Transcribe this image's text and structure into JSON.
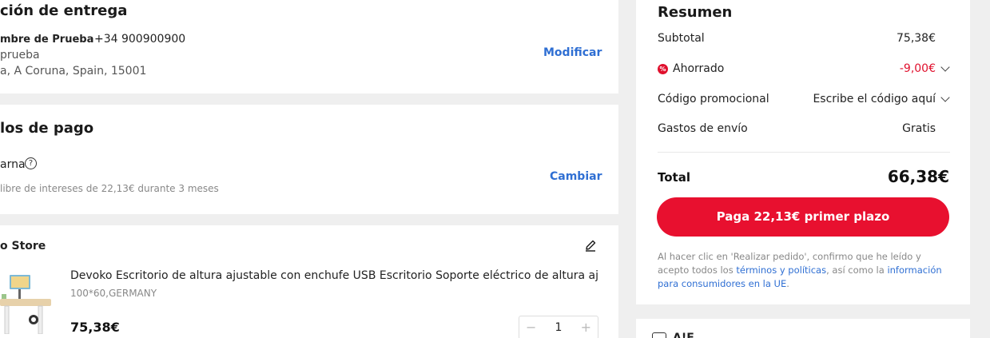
{
  "delivery": {
    "title": "ción de entrega",
    "name": "mbre de Prueba",
    "phone": "+34 900900900",
    "line1": "prueba",
    "line2": "a, A Coruna, Spain, 15001",
    "edit_label": "Modificar"
  },
  "payment": {
    "title": "los de pago",
    "method": "arna",
    "help_glyph": "?",
    "detail": "libre de intereses de 22,13€ durante 3 meses",
    "change_label": "Cambiar"
  },
  "store": {
    "name": "o Store",
    "edit_icon": "pencil-icon",
    "product": {
      "title": "Devoko Escritorio de altura ajustable con enchufe USB Escritorio Soporte eléctrico de altura ajus",
      "variant": "100*60,GERMANY",
      "price": "75,38€",
      "quantity": "1",
      "minus": "−",
      "plus": "+"
    }
  },
  "summary": {
    "title": "Resumen",
    "subtotal_label": "Subtotal",
    "subtotal_value": "75,38€",
    "saved_label": "Ahorrado",
    "saved_value": "-9,00€",
    "saved_icon_glyph": "%",
    "promo_label": "Código promocional",
    "promo_value": "Escribe el código aquí",
    "shipping_label": "Gastos de envío",
    "shipping_value": "Gratis",
    "total_label": "Total",
    "total_value": "66,38€",
    "pay_button": "Paga 22,13€ primer plazo",
    "legal_1": "Al hacer clic en 'Realizar pedido', confirmo que he leído y acepto todos los ",
    "legal_terms": "términos y políticas",
    "legal_2": ", así como la ",
    "legal_info": "información para consumidores en la UE",
    "legal_3": "."
  },
  "bottom_card": {
    "text": "A!F"
  },
  "colors": {
    "accent_red": "#e8102f",
    "link_blue": "#2f6fd3",
    "background": "#efefef"
  }
}
